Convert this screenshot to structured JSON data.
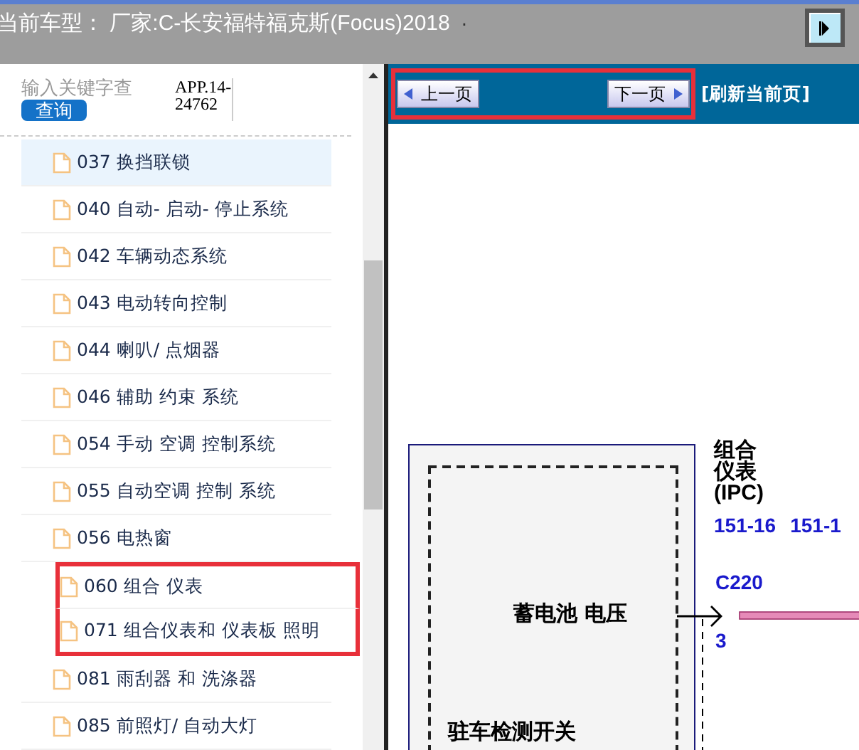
{
  "header": {
    "current_model": "当前车型： 厂家:C-长安福特福克斯(Focus)2018",
    "dot": "."
  },
  "search": {
    "placeholder": "输入关键字查",
    "button": "查询",
    "app_code": "APP.14-24762"
  },
  "items": [
    {
      "label": "037 换挡联锁",
      "selected": true,
      "highlighted": false
    },
    {
      "label": "040 自动- 启动- 停止系统",
      "selected": false,
      "highlighted": false
    },
    {
      "label": "042 车辆动态系统",
      "selected": false,
      "highlighted": false
    },
    {
      "label": "043 电动转向控制",
      "selected": false,
      "highlighted": false
    },
    {
      "label": "044 喇叭/ 点烟器",
      "selected": false,
      "highlighted": false
    },
    {
      "label": "046 辅助 约束 系统",
      "selected": false,
      "highlighted": false
    },
    {
      "label": "054 手动 空调 控制系统",
      "selected": false,
      "highlighted": false
    },
    {
      "label": "055 自动空调 控制 系统",
      "selected": false,
      "highlighted": false
    },
    {
      "label": "056 电热窗",
      "selected": false,
      "highlighted": false
    },
    {
      "label": "060 组合 仪表",
      "selected": false,
      "highlighted": true
    },
    {
      "label": "071 组合仪表和 仪表板 照明",
      "selected": false,
      "highlighted": true
    },
    {
      "label": "081 雨刮器 和 洗涤器",
      "selected": false,
      "highlighted": false
    },
    {
      "label": "085 前照灯/ 自动大灯",
      "selected": false,
      "highlighted": false
    }
  ],
  "nav": {
    "prev": "上一页",
    "next": "下一页",
    "refresh": "[刷新当前页]",
    "highlighted": true
  },
  "diagram": {
    "module_name": "蓄电池 电压",
    "switch_name": "驻车检测开关",
    "component_lines": [
      "组合",
      "仪表",
      "(IPC)"
    ],
    "pins": [
      "151-16",
      "151-1"
    ],
    "connector": "C220",
    "pin_number": "3"
  }
}
